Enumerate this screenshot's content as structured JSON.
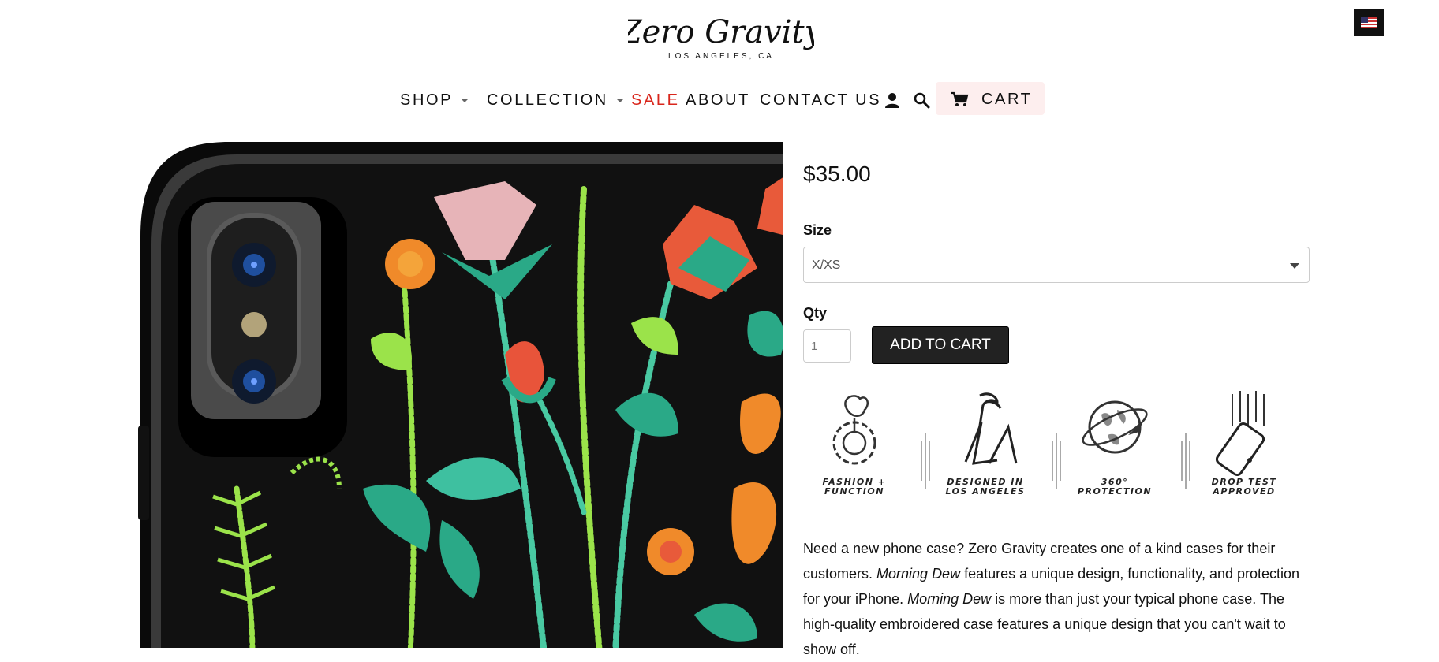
{
  "brand": {
    "logo_script": "Zero Gravity",
    "logo_sub": "LOS ANGELES, CA"
  },
  "region": {
    "flag": "us-flag-icon"
  },
  "nav": {
    "shop": "SHOP",
    "collection": "COLLECTION",
    "sale": "SALE",
    "about": "ABOUT",
    "contact": "CONTACT US",
    "cart": "CART",
    "sale_color": "#d9261c",
    "cart_bg": "#fdeeee"
  },
  "product": {
    "price": "$35.00",
    "size_label": "Size",
    "size_value": "X/XS",
    "qty_label": "Qty",
    "qty_value": "1",
    "add_to_cart": "ADD TO CART",
    "features": [
      {
        "icon": "rose-gear-icon",
        "caption_line1": "FASHION +",
        "caption_line2": "FUNCTION"
      },
      {
        "icon": "palm-la-icon",
        "caption_line1": "DESIGNED IN",
        "caption_line2": "LOS ANGELES"
      },
      {
        "icon": "globe-icon",
        "caption_line1": "360°",
        "caption_line2": "PROTECTION"
      },
      {
        "icon": "phone-drop-icon",
        "caption_line1": "DROP TEST",
        "caption_line2": "APPROVED"
      }
    ],
    "description_parts": {
      "p1": "Need a new phone case? Zero Gravity creates one of a kind cases for their customers. ",
      "em1": "Morning Dew",
      "p2": " features a unique design, functionality, and protection for your iPhone. ",
      "em2": "Morning Dew",
      "p3": " is more than just your typical phone case. The high-quality embroidered case features a unique design that you can't wait to show off."
    }
  }
}
